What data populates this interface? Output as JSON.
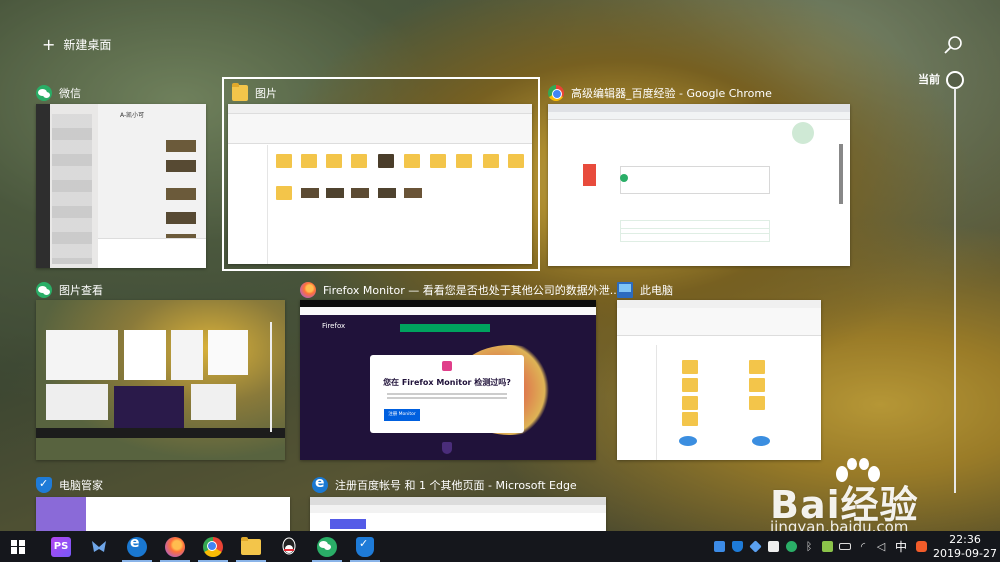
{
  "top": {
    "new_desktop_label": "新建桌面"
  },
  "timeline": {
    "current_label": "当前"
  },
  "windows": {
    "wechat": {
      "title": "微信",
      "chat_title": "A-凯小可"
    },
    "pictures": {
      "title": "图片"
    },
    "chrome": {
      "title": "高级编辑器_百度经验 - Google Chrome"
    },
    "photo_viewer": {
      "title": "图片查看"
    },
    "firefox": {
      "title": "Firefox Monitor — 看看您是否也处于其他公司的数据外泄...",
      "brand": "Firefox",
      "headline": "您在 Firefox Monitor 检测过吗?",
      "button": "注册 Monitor"
    },
    "this_pc": {
      "title": "此电脑"
    },
    "pc_manager": {
      "title": "电脑管家"
    },
    "edge": {
      "title": "注册百度帐号 和 1 个其他页面 - Microsoft Edge"
    }
  },
  "taskbar": {
    "apps": [
      {
        "name": "start",
        "icon": "windows-logo-icon"
      },
      {
        "name": "phpstorm",
        "icon": "phpstorm-icon",
        "label": "PS"
      },
      {
        "name": "feishu",
        "icon": "bird-app-icon"
      },
      {
        "name": "edge",
        "icon": "edge-icon"
      },
      {
        "name": "firefox",
        "icon": "firefox-icon"
      },
      {
        "name": "chrome",
        "icon": "chrome-icon"
      },
      {
        "name": "explorer",
        "icon": "folder-icon"
      },
      {
        "name": "qq",
        "icon": "qq-icon"
      },
      {
        "name": "wechat",
        "icon": "wechat-icon"
      },
      {
        "name": "pc_manager",
        "icon": "shield-icon"
      }
    ],
    "ime": "中",
    "time": "22:36",
    "date": "2019-09-27"
  },
  "watermark": {
    "text": "Bai经验",
    "url": "jingyan.baidu.com"
  },
  "colors": {
    "taskbar": "#15171c",
    "firefox_purple": "#20123a",
    "monitor_button": "#0060df",
    "wechat_green": "#2aae67"
  }
}
